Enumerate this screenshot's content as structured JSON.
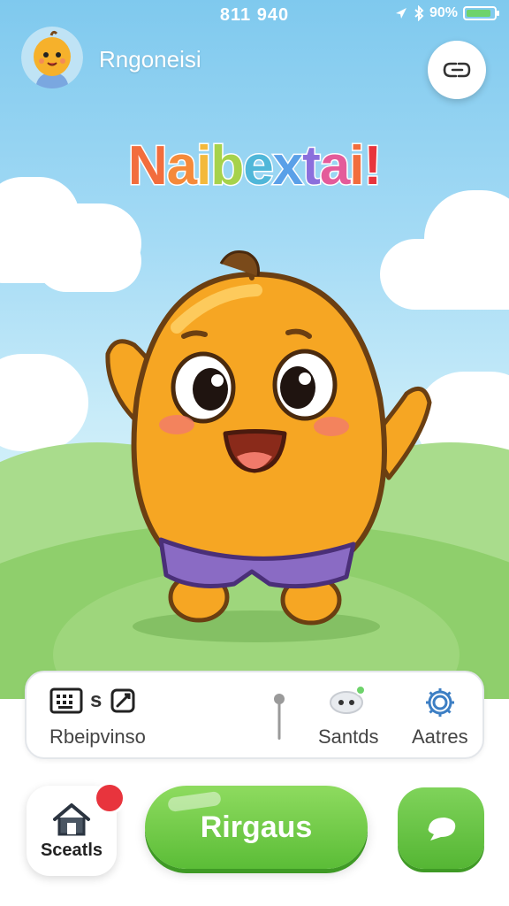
{
  "status": {
    "time": "811 940",
    "battery_text": "90%",
    "battery_level": 0.9,
    "icons": [
      "navigation-icon",
      "bluetooth-icon",
      "battery-icon"
    ]
  },
  "header": {
    "username": "Rngoneisi",
    "avatar_icon": "chick-avatar-icon",
    "action_icon": "link-icon"
  },
  "title": {
    "letters": [
      "N",
      "a",
      "i",
      "b",
      "e",
      "x",
      "t",
      "a",
      "i",
      "!"
    ],
    "colors": [
      "#f26d3d",
      "#f58a3a",
      "#f3b93c",
      "#a6d24b",
      "#4fb7d9",
      "#5aa0e8",
      "#8b6fdc",
      "#e45b9a",
      "#f26d3d",
      "#e8343d"
    ]
  },
  "toolbar": {
    "left_icon_text": "s",
    "left_label": "Rbeipvinso",
    "sounds_label": "Santds",
    "settings_label": "Aatres"
  },
  "bottom": {
    "home_label": "Sceatls",
    "main_button_label": "Rirgaus",
    "chat_icon": "chat-bubble-icon"
  },
  "colors": {
    "accent_green": "#5bbd37",
    "sky": "#7fc9ee",
    "mascot_orange": "#f6a623",
    "badge_red": "#e8343d"
  }
}
